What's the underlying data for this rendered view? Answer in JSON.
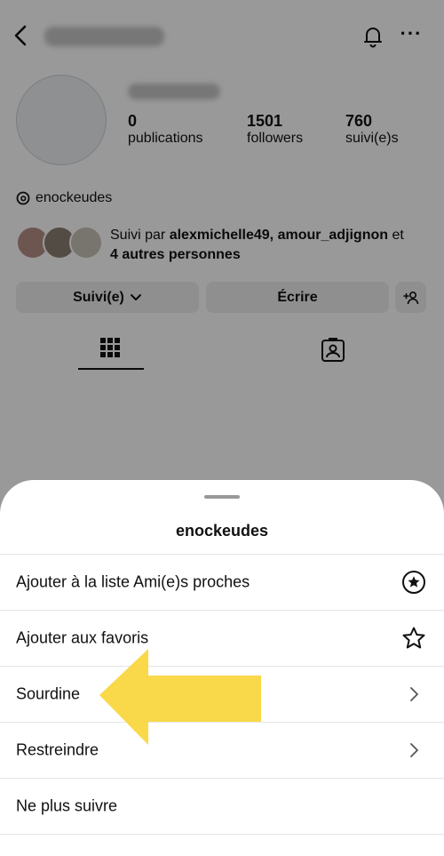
{
  "profile": {
    "stats": [
      {
        "value": "0",
        "label": "publications"
      },
      {
        "value": "1501",
        "label": "followers"
      },
      {
        "value": "760",
        "label": "suivi(e)s"
      }
    ],
    "threads_handle": "enockeudes",
    "followed_by": {
      "prefix": "Suivi par ",
      "names": "alexmichelle49, amour_adjignon",
      "suffix": " et",
      "others": "4 autres personnes"
    },
    "buttons": {
      "following": "Suivi(e)",
      "message": "Écrire"
    }
  },
  "sheet": {
    "title": "enockeudes",
    "items": [
      {
        "label": "Ajouter à la liste Ami(e)s proches",
        "icon": "star-circle-icon"
      },
      {
        "label": "Ajouter aux favoris",
        "icon": "star-outline-icon"
      },
      {
        "label": "Sourdine",
        "icon": "chevron-right-icon"
      },
      {
        "label": "Restreindre",
        "icon": "chevron-right-icon"
      },
      {
        "label": "Ne plus suivre",
        "icon": ""
      }
    ]
  },
  "colors": {
    "annotation_arrow": "#f9d84a",
    "overlay": "rgba(0,0,0,0.40)"
  }
}
